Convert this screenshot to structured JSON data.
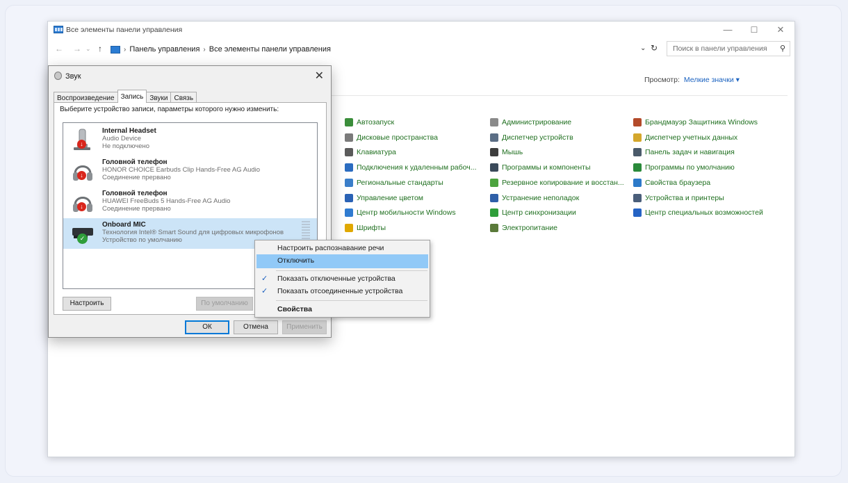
{
  "window": {
    "title": "Все элементы панели управления",
    "breadcrumb": [
      "Панель управления",
      "Все элементы панели управления"
    ],
    "search_placeholder": "Поиск в панели управления",
    "controls": {
      "minimize": "—",
      "maximize": "☐",
      "close": "✕"
    }
  },
  "view": {
    "label": "Просмотр:",
    "value": "Мелкие значки ▾"
  },
  "cp": {
    "items": [
      {
        "label": "Автозапуск",
        "icon": "autoplay-icon",
        "color": "#3a8d3a"
      },
      {
        "label": "Дисковые пространства",
        "icon": "storage-icon",
        "color": "#7a7a7a"
      },
      {
        "label": "Клавиатура",
        "icon": "keyboard-icon",
        "color": "#5a5a5a"
      },
      {
        "label": "Подключения к удаленным рабоч...",
        "icon": "remote-icon",
        "color": "#2b6cc0"
      },
      {
        "label": "Региональные стандарты",
        "icon": "region-icon",
        "color": "#3a7ec9"
      },
      {
        "label": "Управление цветом",
        "icon": "color-icon",
        "color": "#2a62b5"
      },
      {
        "label": "Центр мобильности Windows",
        "icon": "mobility-icon",
        "color": "#2f7bd0"
      },
      {
        "label": "Шрифты",
        "icon": "fonts-icon",
        "color": "#e0a800"
      },
      {
        "label": "Администрирование",
        "icon": "admin-icon",
        "color": "#8a8a8a"
      },
      {
        "label": "Диспетчер устройств",
        "icon": "device-manager-icon",
        "color": "#5b6e85"
      },
      {
        "label": "Мышь",
        "icon": "mouse-icon",
        "color": "#3d3d3d"
      },
      {
        "label": "Программы и компоненты",
        "icon": "programs-icon",
        "color": "#3a4a5a"
      },
      {
        "label": "Резервное копирование и восстан...",
        "icon": "backup-icon",
        "color": "#4ca33f"
      },
      {
        "label": "Устранение неполадок",
        "icon": "troubleshoot-icon",
        "color": "#2e5fa8"
      },
      {
        "label": "Центр синхронизации",
        "icon": "sync-icon",
        "color": "#2f9e3a"
      },
      {
        "label": "Электропитание",
        "icon": "power-icon",
        "color": "#5a7a3a"
      },
      {
        "label": "Брандмауэр Защитника Windows",
        "icon": "firewall-icon",
        "color": "#b34a2a"
      },
      {
        "label": "Диспетчер учетных данных",
        "icon": "credentials-icon",
        "color": "#d4a72c"
      },
      {
        "label": "Панель задач и навигация",
        "icon": "taskbar-icon",
        "color": "#4a5a6a"
      },
      {
        "label": "Программы по умолчанию",
        "icon": "default-programs-icon",
        "color": "#2a8a3a"
      },
      {
        "label": "Свойства браузера",
        "icon": "browser-icon",
        "color": "#2c7ac9"
      },
      {
        "label": "Устройства и принтеры",
        "icon": "printers-icon",
        "color": "#4a5e7a"
      },
      {
        "label": "Центр специальных возможностей",
        "icon": "accessibility-icon",
        "color": "#2563c4"
      }
    ]
  },
  "sound": {
    "title": "Звук",
    "tabs": [
      "Воспроизведение",
      "Запись",
      "Звуки",
      "Связь"
    ],
    "prompt": "Выберите устройство записи, параметры которого нужно изменить:",
    "devices": [
      {
        "name": "Internal Headset",
        "desc": "Audio Device",
        "status": "Не подключено"
      },
      {
        "name": "Головной телефон",
        "desc": "HONOR CHOICE Earbuds Clip Hands-Free AG Audio",
        "status": "Соединение прервано"
      },
      {
        "name": "Головной телефон",
        "desc": "HUAWEI FreeBuds 5 Hands-Free AG Audio",
        "status": "Соединение прервано"
      },
      {
        "name": "Onboard MIC",
        "desc": "Технология Intel® Smart Sound для цифровых микрофонов",
        "status": "Устройство по умолчанию"
      }
    ],
    "buttons": {
      "configure": "Настроить",
      "default": "По умолчанию",
      "ok": "ОК",
      "cancel": "Отмена",
      "apply": "Применить"
    }
  },
  "menu": {
    "items": [
      "Настроить распознавание речи",
      "Отключить",
      "Показать отключенные устройства",
      "Показать отсоединенные устройства",
      "Свойства"
    ],
    "check": "✓"
  }
}
